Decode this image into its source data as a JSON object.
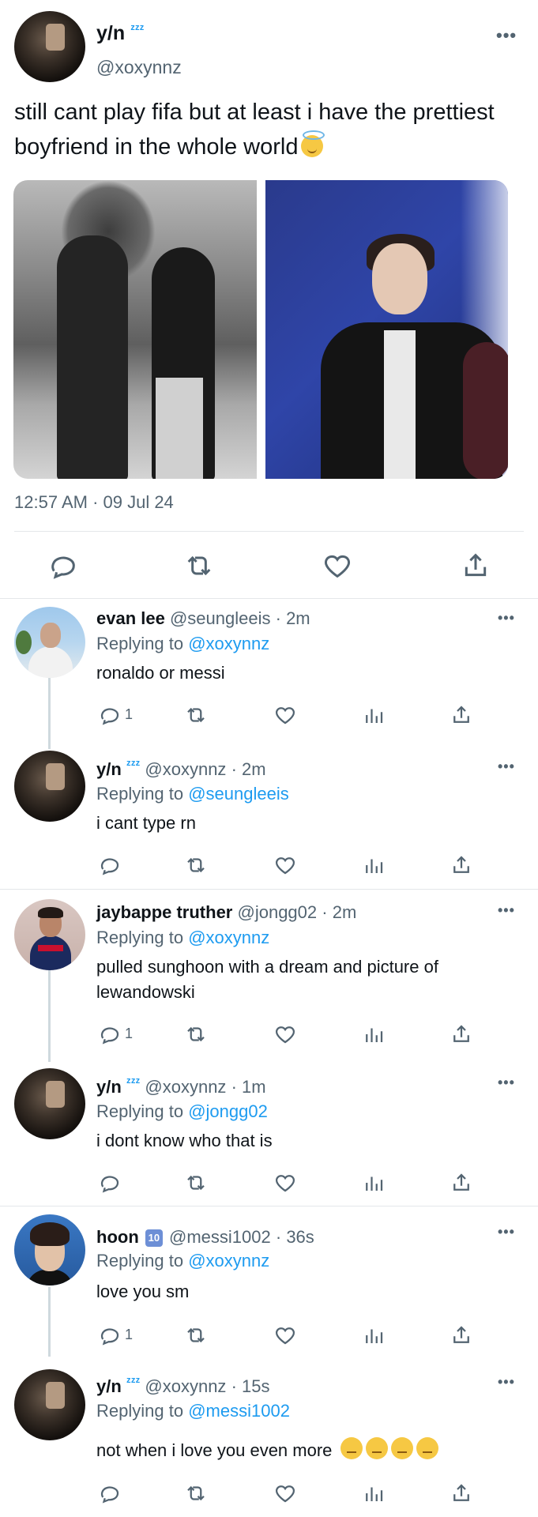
{
  "main_tweet": {
    "name": "y/n",
    "name_badge": "ᶻᶻᶻ",
    "handle": "@xoxynnz",
    "more": "•••",
    "text": "still cant play fifa but at least i have the prettiest boyfriend in the whole world",
    "text_emoji": "smiling-face-with-halo",
    "timestamp": "12:57 AM · 09 Jul 24",
    "actions": [
      "reply-icon",
      "retweet-icon",
      "like-icon",
      "share-icon"
    ]
  },
  "replies": [
    {
      "name": "evan lee",
      "handle": "@seungleeis",
      "time": "· 2m",
      "replying_prefix": "Replying to",
      "replying_to": "@xoxynnz",
      "text": "ronaldo or messi",
      "reply_count": "1",
      "more": "•••"
    },
    {
      "name": "y/n",
      "name_badge": "ᶻᶻᶻ",
      "handle": "@xoxynnz",
      "time": "· 2m",
      "replying_prefix": "Replying to",
      "replying_to": "@seungleeis",
      "text": "i cant type rn",
      "reply_count": "",
      "more": "•••"
    },
    {
      "name": "jaybappe truther",
      "handle": "@jongg02",
      "time": "· 2m",
      "replying_prefix": "Replying to",
      "replying_to": "@xoxynnz",
      "text": "pulled sunghoon with a dream and picture of lewandowski",
      "reply_count": "1",
      "more": "•••"
    },
    {
      "name": "y/n",
      "name_badge": "ᶻᶻᶻ",
      "handle": "@xoxynnz",
      "time": "· 1m",
      "replying_prefix": "Replying to",
      "replying_to": "@jongg02",
      "text": "i dont know who that is",
      "reply_count": "",
      "more": "•••"
    },
    {
      "name": "hoon",
      "name_badge": "10",
      "handle": "@messi1002",
      "time": "· 36s",
      "replying_prefix": "Replying to",
      "replying_to": "@xoxynnz",
      "text": "love you sm",
      "reply_count": "1",
      "more": "•••"
    },
    {
      "name": "y/n",
      "name_badge": "ᶻᶻᶻ",
      "handle": "@xoxynnz",
      "time": "· 15s",
      "replying_prefix": "Replying to",
      "replying_to": "@messi1002",
      "text": "not when i love you even more",
      "text_emoji": "neutral-face x4",
      "reply_count": "",
      "more": "•••"
    }
  ],
  "colors": {
    "text": "#0f1419",
    "secondary": "#536471",
    "link": "#1d9bf0",
    "divider": "#e4e7ea"
  }
}
